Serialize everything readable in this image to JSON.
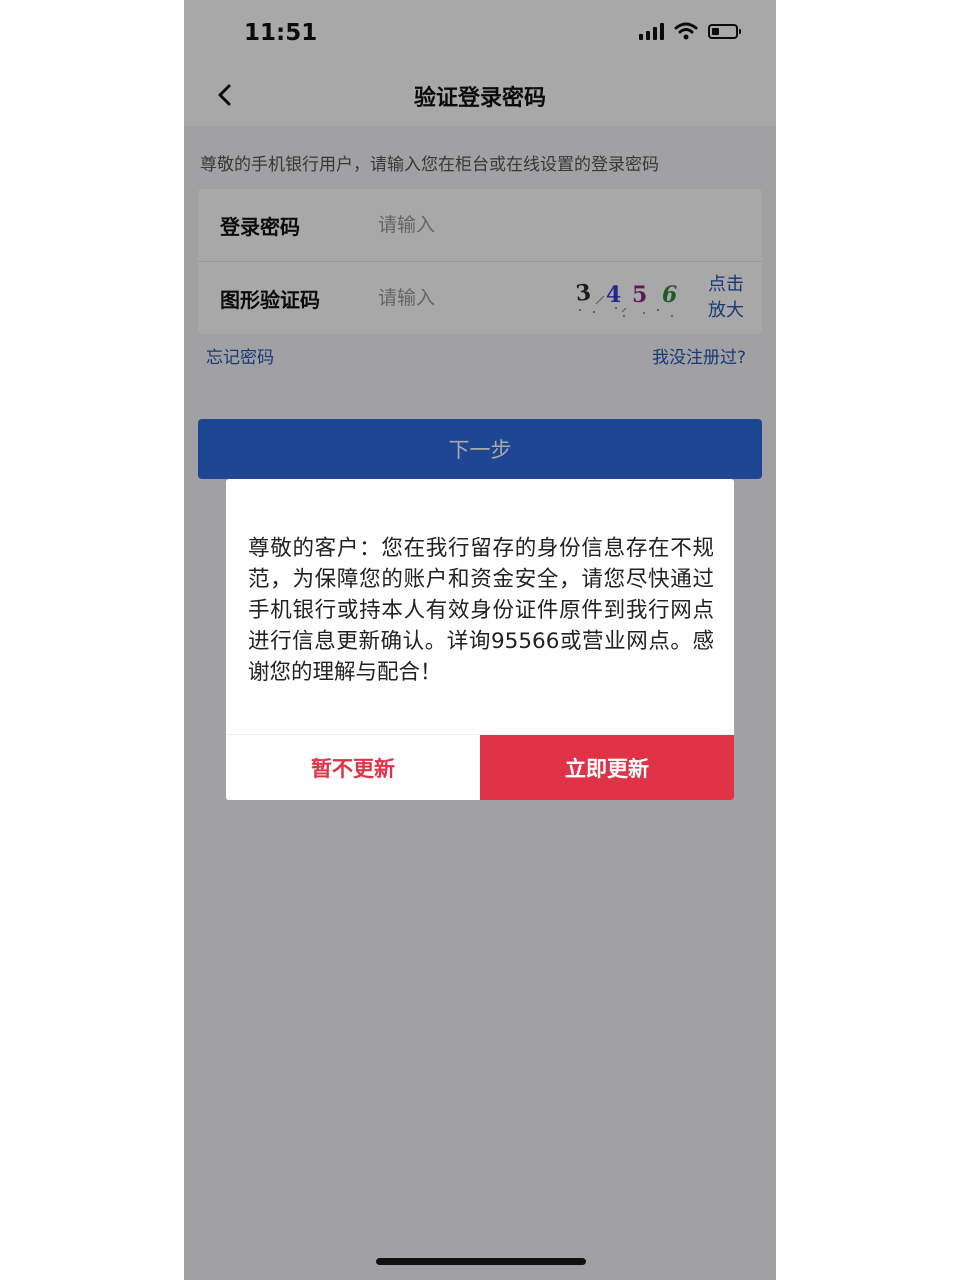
{
  "status_bar": {
    "time": "11:51"
  },
  "nav": {
    "title": "验证登录密码",
    "back_icon": "chevron-left-icon"
  },
  "hint": "尊敬的手机银行用户，请输入您在柜台或在线设置的登录密码",
  "form": {
    "password": {
      "label": "登录密码",
      "placeholder": "请输入"
    },
    "captcha": {
      "label": "图形验证码",
      "placeholder": "请输入",
      "image_text": [
        "3",
        "4",
        "5",
        "6"
      ],
      "zoom_label_line1": "点击",
      "zoom_label_line2": "放大"
    }
  },
  "links": {
    "forgot": "忘记密码",
    "register": "我没注册过?"
  },
  "next_button": "下一步",
  "dialog": {
    "message": "尊敬的客户：您在我行留存的身份信息存在不规范，为保障您的账户和资金安全，请您尽快通过手机银行或持本人有效身份证件原件到我行网点进行信息更新确认。详询95566或营业网点。感谢您的理解与配合！",
    "later_button": "暂不更新",
    "update_button": "立即更新"
  },
  "colors": {
    "primary_blue": "#2f6bdf",
    "link_blue": "#2456b8",
    "accent_red": "#e03347"
  }
}
